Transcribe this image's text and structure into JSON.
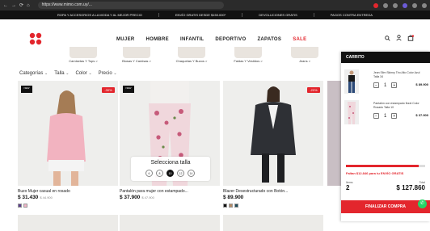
{
  "browser": {
    "url": "https://www.mimo.com.uy/..."
  },
  "promo": [
    "ROPA Y ACCESORIOS A LA MODA Y AL MEJOR PRECIO",
    "ENVÍO GRATIS DESDE $150.000*",
    "DEVOLUCIONES GRATIS",
    "PAGOS CONTRA ENTREGA"
  ],
  "header": {
    "logo_name": "mimo-logo",
    "menu": [
      "MUJER",
      "HOMBRE",
      "INFANTIL",
      "DEPORTIVO",
      "ZAPATOS",
      "SALE"
    ]
  },
  "categories": [
    "Camisetas Y Tops >",
    "Blusas Y Camisas >",
    "Chaquetas Y Buzos >",
    "Faldas Y Vestidos >",
    "Jeans >"
  ],
  "filters": [
    "Categorías",
    "Talla",
    "Color",
    "Precio"
  ],
  "products": [
    {
      "badge": "NEW",
      "discount": "-30%",
      "name": "Buzo Mujer casual en rosado",
      "price": "$ 31.430",
      "old_price": "$ 44.900",
      "swatch_colors": [
        "#5b3f8c",
        "#f2b7c8"
      ]
    },
    {
      "badge": "NEW",
      "discount": "",
      "name": "Pantalón para mujer con estampado...",
      "price": "$ 37.900",
      "old_price": "$ 47.900",
      "swatch_colors": []
    },
    {
      "badge": "",
      "discount": "-20%",
      "name": "Blazer Desestructurado con Botón...",
      "price": "$ 89.900",
      "old_price": "",
      "swatch_colors": [
        "#111111",
        "#b28a66",
        "#1e4b5a"
      ]
    }
  ],
  "size_selector": {
    "title": "Selecciona talla",
    "sizes": [
      "6",
      "8",
      "10",
      "12",
      "14"
    ],
    "selected_index": 2
  },
  "cart": {
    "title": "CARRITO",
    "items": [
      {
        "name": "Jean Slim Skinny Tiro Alto Color Azul Talla 34",
        "qty": "1",
        "price": "$ 89.900"
      },
      {
        "name": "Pantalón con estampado floral Color Rosado Talla 10",
        "qty": "1",
        "price": "$ 37.900"
      }
    ],
    "ship_progress": 0.92,
    "ship_text": "Faltan $12.846 para tu ENVÍO GRATIS",
    "items_label": "Items",
    "items_count": "2",
    "total_label": "Total",
    "total_value": "$ 127.860",
    "checkout_label": "FINALIZAR COMPRA"
  },
  "colors": {
    "accent": "#e3262d",
    "dark": "#111111"
  }
}
